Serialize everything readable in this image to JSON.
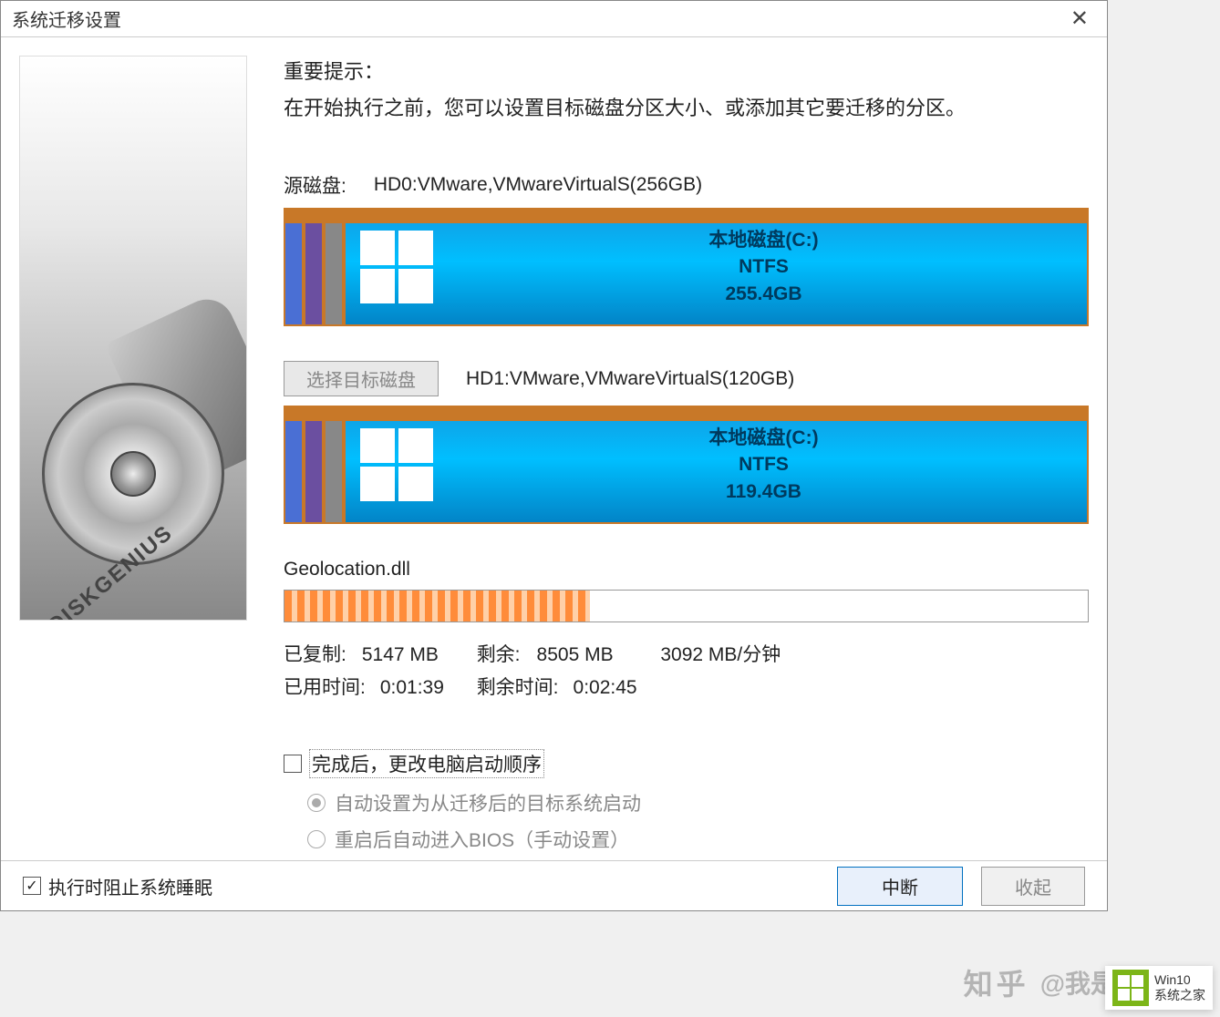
{
  "window": {
    "title": "系统迁移设置",
    "close": "✕"
  },
  "sidebar": {
    "brand": "DISKGENIUS"
  },
  "hint": {
    "title": "重要提示：",
    "text": "在开始执行之前，您可以设置目标磁盘分区大小、或添加其它要迁移的分区。"
  },
  "source": {
    "label": "源磁盘:",
    "value": "HD0:VMware,VMwareVirtualS(256GB)",
    "partition": {
      "name": "本地磁盘(C:)",
      "fs": "NTFS",
      "size": "255.4GB"
    }
  },
  "target": {
    "select_btn": "选择目标磁盘",
    "value": "HD1:VMware,VMwareVirtualS(120GB)",
    "partition": {
      "name": "本地磁盘(C:)",
      "fs": "NTFS",
      "size": "119.4GB"
    }
  },
  "progress": {
    "current_file": "Geolocation.dll",
    "copied_label": "已复制:",
    "copied_value": "5147 MB",
    "remain_label": "剩余:",
    "remain_value": "8505 MB",
    "speed": "3092 MB/分钟",
    "elapsed_label": "已用时间:",
    "elapsed_value": "0:01:39",
    "remain_time_label": "剩余时间:",
    "remain_time_value": "0:02:45"
  },
  "options": {
    "change_boot": "完成后，更改电脑启动顺序",
    "radio_auto": "自动设置为从迁移后的目标系统启动",
    "radio_bios": "重启后自动进入BIOS（手动设置）"
  },
  "bottom": {
    "prevent_sleep": "执行时阻止系统睡眠",
    "interrupt": "中断",
    "collapse": "收起"
  },
  "watermark": {
    "zhihu": "知乎",
    "author": "@我是简特快"
  },
  "corner": {
    "line1": "Win10",
    "line2": "系统之家"
  }
}
